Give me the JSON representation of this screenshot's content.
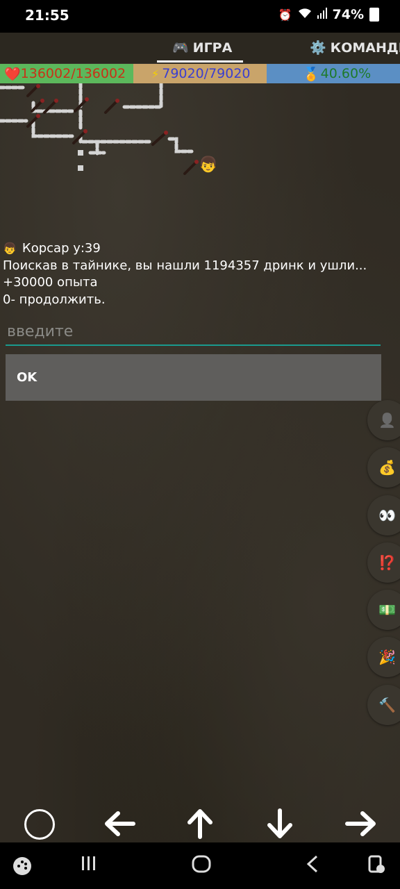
{
  "status_bar": {
    "time": "21:55",
    "battery": "74%",
    "icons": [
      "alarm-icon",
      "wifi-icon",
      "signal-icon",
      "battery-icon"
    ]
  },
  "tabs": [
    {
      "label": "ИГРА",
      "icon": "gamepad-icon",
      "active": true
    },
    {
      "label": "КОМАНДЫ",
      "icon": "gear-icon",
      "active": false
    }
  ],
  "stats": {
    "hp": "136002/136002",
    "energy": "79020/79020",
    "xp": "40.60%",
    "colors": {
      "hp_bg": "#5cb85c",
      "energy_bg": "#c9a46a",
      "xp_bg": "#5b8fc4"
    }
  },
  "message": {
    "name_line": "Корсар  у:39",
    "line1": "Поискав в тайнике, вы нашли 1194357 дринк и ушли...",
    "line2": "+30000 опыта",
    "line3": "0- продолжить."
  },
  "input": {
    "placeholder": "введите",
    "value": ""
  },
  "ok_button": {
    "label": "OK"
  },
  "side_buttons": [
    "profile-icon",
    "money-bag-icon",
    "eyes-icon",
    "interrobang-icon",
    "banknote-icon",
    "party-popper-icon",
    "hammer-icon"
  ],
  "side_glyphs": [
    "👤",
    "💰",
    "👀",
    "⁉️",
    "💵",
    "🎉",
    "🔨"
  ],
  "controls": {
    "circle": "action",
    "left": "←",
    "up": "↑",
    "down": "↓",
    "right": "→"
  }
}
